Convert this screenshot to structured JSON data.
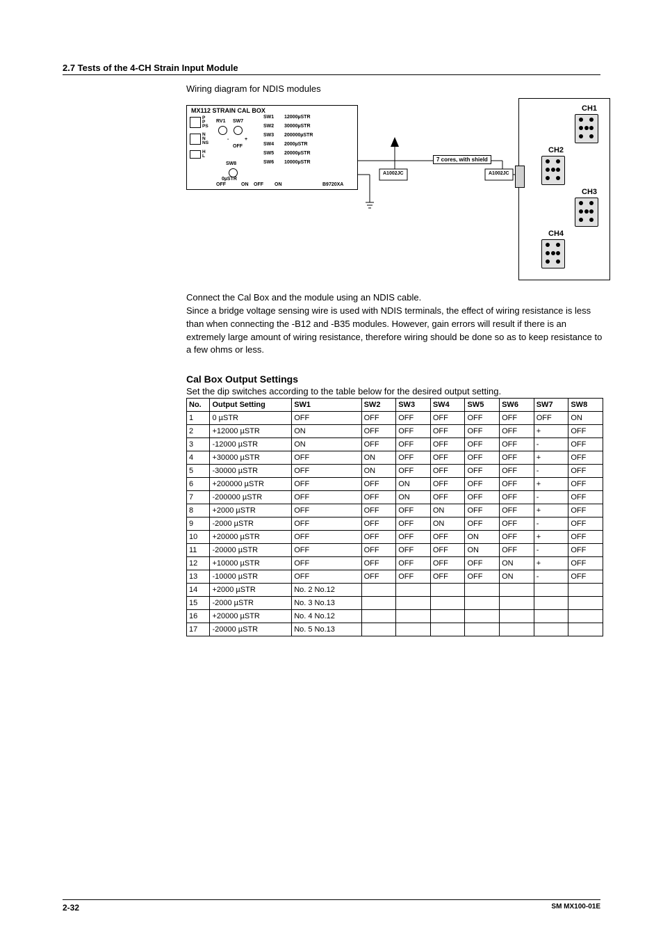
{
  "header": {
    "section": "2.7  Tests of the 4-CH Strain Input Module"
  },
  "diagram": {
    "caption": "Wiring diagram for NDIS modules",
    "calbox_title": "MX112 STRAIN CAL BOX",
    "sw_labels": {
      "sw1": "SW1",
      "sw2": "SW2",
      "sw3": "SW3",
      "sw4": "SW4",
      "sw5": "SW5",
      "sw6": "SW6",
      "sw7": "SW7",
      "sw8": "SW8"
    },
    "sw_ranges": {
      "sw1": "12000µSTR",
      "sw2": "30000µSTR",
      "sw3": "200000µSTR",
      "sw4": "2000µSTR",
      "sw5": "20000µSTR",
      "sw6": "10000µSTR"
    },
    "pins": {
      "block1": "P\nP\nPS",
      "block2": "N\nN\nNS",
      "block3": "H\nL"
    },
    "rv1": "RV1",
    "plus": "+",
    "minus": "-",
    "off": "OFF",
    "on": "ON",
    "zero": "0µSTR",
    "model": "B9720XA",
    "a1002jc": "A1002JC",
    "cable_note": "7 cores, with shield",
    "ch1": "CH1",
    "ch2": "CH2",
    "ch3": "CH3",
    "ch4": "CH4"
  },
  "body": {
    "p1": "Connect the Cal Box and the module using an NDIS cable.",
    "p2": "Since a bridge voltage sensing wire is used with NDIS terminals, the effect of wiring resistance is less than when connecting the -B12 and -B35 modules. However, gain errors will result if there is an extremely large amount of wiring resistance, therefore wiring should be done so as to keep resistance to a few ohms or less."
  },
  "calset": {
    "heading": "Cal Box Output Settings",
    "lead": "Set the dip switches according to the table below for the desired output setting.",
    "headers": {
      "no": "No.",
      "out": "Output Setting",
      "sw1": "SW1",
      "sw2": "SW2",
      "sw3": "SW3",
      "sw4": "SW4",
      "sw5": "SW5",
      "sw6": "SW6",
      "sw7": "SW7",
      "sw8": "SW8"
    },
    "rows": [
      {
        "no": "1",
        "out": "0 µSTR",
        "sw1": "OFF",
        "sw2": "OFF",
        "sw3": "OFF",
        "sw4": "OFF",
        "sw5": "OFF",
        "sw6": "OFF",
        "sw7": "OFF",
        "sw8": "ON"
      },
      {
        "no": "2",
        "out": "+12000 µSTR",
        "sw1": "ON",
        "sw2": "OFF",
        "sw3": "OFF",
        "sw4": "OFF",
        "sw5": "OFF",
        "sw6": "OFF",
        "sw7": "+",
        "sw8": "OFF"
      },
      {
        "no": "3",
        "out": "-12000 µSTR",
        "sw1": "ON",
        "sw2": "OFF",
        "sw3": "OFF",
        "sw4": "OFF",
        "sw5": "OFF",
        "sw6": "OFF",
        "sw7": "-",
        "sw8": "OFF"
      },
      {
        "no": "4",
        "out": "+30000 µSTR",
        "sw1": "OFF",
        "sw2": "ON",
        "sw3": "OFF",
        "sw4": "OFF",
        "sw5": "OFF",
        "sw6": "OFF",
        "sw7": "+",
        "sw8": "OFF"
      },
      {
        "no": "5",
        "out": "-30000 µSTR",
        "sw1": "OFF",
        "sw2": "ON",
        "sw3": "OFF",
        "sw4": "OFF",
        "sw5": "OFF",
        "sw6": "OFF",
        "sw7": "-",
        "sw8": "OFF"
      },
      {
        "no": "6",
        "out": "+200000 µSTR",
        "sw1": "OFF",
        "sw2": "OFF",
        "sw3": "ON",
        "sw4": "OFF",
        "sw5": "OFF",
        "sw6": "OFF",
        "sw7": "+",
        "sw8": "OFF"
      },
      {
        "no": "7",
        "out": "-200000 µSTR",
        "sw1": "OFF",
        "sw2": "OFF",
        "sw3": "ON",
        "sw4": "OFF",
        "sw5": "OFF",
        "sw6": "OFF",
        "sw7": "-",
        "sw8": "OFF"
      },
      {
        "no": "8",
        "out": "+2000 µSTR",
        "sw1": "OFF",
        "sw2": "OFF",
        "sw3": "OFF",
        "sw4": "ON",
        "sw5": "OFF",
        "sw6": "OFF",
        "sw7": "+",
        "sw8": "OFF"
      },
      {
        "no": "9",
        "out": "-2000 µSTR",
        "sw1": "OFF",
        "sw2": "OFF",
        "sw3": "OFF",
        "sw4": "ON",
        "sw5": "OFF",
        "sw6": "OFF",
        "sw7": "-",
        "sw8": "OFF"
      },
      {
        "no": "10",
        "out": "+20000 µSTR",
        "sw1": "OFF",
        "sw2": "OFF",
        "sw3": "OFF",
        "sw4": "OFF",
        "sw5": "ON",
        "sw6": "OFF",
        "sw7": "+",
        "sw8": "OFF"
      },
      {
        "no": "11",
        "out": "-20000 µSTR",
        "sw1": "OFF",
        "sw2": "OFF",
        "sw3": "OFF",
        "sw4": "OFF",
        "sw5": "ON",
        "sw6": "OFF",
        "sw7": "-",
        "sw8": "OFF"
      },
      {
        "no": "12",
        "out": "+10000 µSTR",
        "sw1": "OFF",
        "sw2": "OFF",
        "sw3": "OFF",
        "sw4": "OFF",
        "sw5": "OFF",
        "sw6": "ON",
        "sw7": "+",
        "sw8": "OFF"
      },
      {
        "no": "13",
        "out": "-10000 µSTR",
        "sw1": "OFF",
        "sw2": "OFF",
        "sw3": "OFF",
        "sw4": "OFF",
        "sw5": "OFF",
        "sw6": "ON",
        "sw7": "-",
        "sw8": "OFF"
      },
      {
        "no": "14",
        "out": "+2000 µSTR",
        "sw1": "No. 2  No.12",
        "sw2": "",
        "sw3": "",
        "sw4": "",
        "sw5": "",
        "sw6": "",
        "sw7": "",
        "sw8": ""
      },
      {
        "no": "15",
        "out": "-2000 µSTR",
        "sw1": "No. 3  No.13",
        "sw2": "",
        "sw3": "",
        "sw4": "",
        "sw5": "",
        "sw6": "",
        "sw7": "",
        "sw8": ""
      },
      {
        "no": "16",
        "out": "+20000 µSTR",
        "sw1": "No. 4  No.12",
        "sw2": "",
        "sw3": "",
        "sw4": "",
        "sw5": "",
        "sw6": "",
        "sw7": "",
        "sw8": ""
      },
      {
        "no": "17",
        "out": "-20000 µSTR",
        "sw1": "No. 5  No.13",
        "sw2": "",
        "sw3": "",
        "sw4": "",
        "sw5": "",
        "sw6": "",
        "sw7": "",
        "sw8": ""
      }
    ]
  },
  "footer": {
    "page": "2-32",
    "docid": "SM MX100-01E"
  }
}
